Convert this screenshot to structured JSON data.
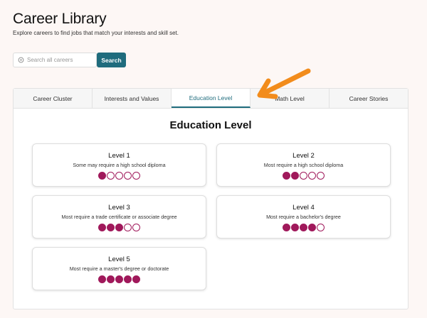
{
  "header": {
    "title": "Career Library",
    "subtitle": "Explore careers to find jobs that match your interests and skill set."
  },
  "search": {
    "placeholder": "Search all careers",
    "button_label": "Search"
  },
  "tabs": [
    {
      "label": "Career Cluster",
      "active": false
    },
    {
      "label": "Interests and Values",
      "active": false
    },
    {
      "label": "Education Level",
      "active": true
    },
    {
      "label": "Math Level",
      "active": false
    },
    {
      "label": "Career Stories",
      "active": false
    }
  ],
  "section": {
    "title": "Education Level"
  },
  "levels": [
    {
      "title": "Level 1",
      "description": "Some may require a high school diploma",
      "filled": 1,
      "total": 5
    },
    {
      "title": "Level 2",
      "description": "Most require a high school diploma",
      "filled": 2,
      "total": 5
    },
    {
      "title": "Level 3",
      "description": "Most require a trade certificate or associate degree",
      "filled": 3,
      "total": 5
    },
    {
      "title": "Level 4",
      "description": "Most require a bachelor's degree",
      "filled": 4,
      "total": 5
    },
    {
      "title": "Level 5",
      "description": "Most require a master's degree or doctorate",
      "filled": 5,
      "total": 5
    }
  ],
  "colors": {
    "accent": "#1f6c7d",
    "dot": "#a0195b",
    "arrow": "#f28c1c",
    "background": "#fdf7f5"
  },
  "annotation": {
    "arrow_icon": "arrow-pointer-icon"
  }
}
